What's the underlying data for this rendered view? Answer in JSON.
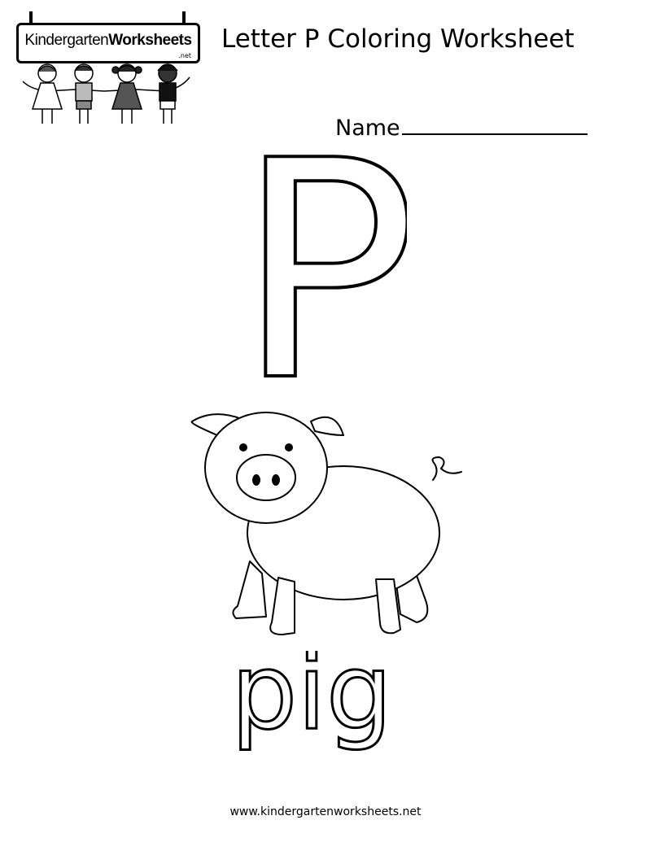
{
  "logo": {
    "brand_part1": "Kindergarten",
    "brand_part2": "Worksheets",
    "brand_suffix": ".net"
  },
  "worksheet": {
    "title": "Letter P Coloring Worksheet",
    "name_label": "Name",
    "letter": "P",
    "word": "pig",
    "picture": "pig-illustration"
  },
  "footer": {
    "url": "www.kindergartenworksheets.net"
  }
}
